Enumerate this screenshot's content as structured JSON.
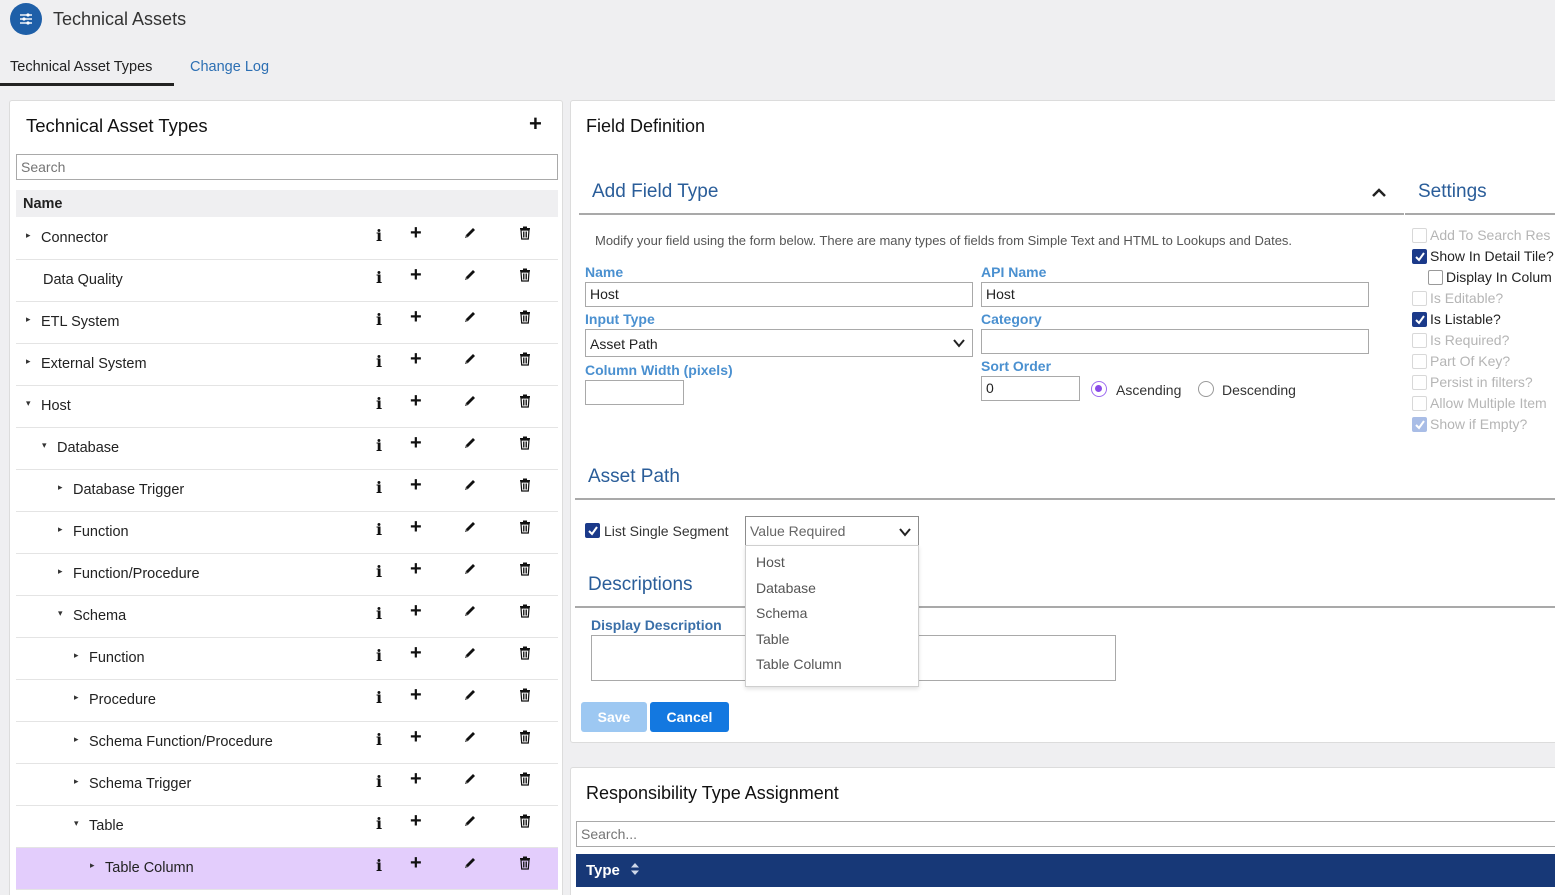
{
  "app": {
    "title": "Technical Assets",
    "icon": "sliders-icon"
  },
  "tabs": [
    {
      "label": "Technical Asset Types",
      "active": true
    },
    {
      "label": "Change Log",
      "active": false
    }
  ],
  "left_panel": {
    "title": "Technical Asset Types",
    "search_placeholder": "Search",
    "column_header": "Name",
    "rows": [
      {
        "label": "Connector",
        "caret": "collapsed",
        "depth": 0
      },
      {
        "label": "Data Quality",
        "caret": "none",
        "depth": 0
      },
      {
        "label": "ETL System",
        "caret": "collapsed",
        "depth": 0
      },
      {
        "label": "External System",
        "caret": "collapsed",
        "depth": 0
      },
      {
        "label": "Host",
        "caret": "expanded",
        "depth": 0
      },
      {
        "label": "Database",
        "caret": "expanded",
        "depth": 1
      },
      {
        "label": "Database Trigger",
        "caret": "collapsed",
        "depth": 2
      },
      {
        "label": "Function",
        "caret": "collapsed",
        "depth": 2
      },
      {
        "label": "Function/Procedure",
        "caret": "collapsed",
        "depth": 2
      },
      {
        "label": "Schema",
        "caret": "expanded",
        "depth": 2
      },
      {
        "label": "Function",
        "caret": "collapsed",
        "depth": 3
      },
      {
        "label": "Procedure",
        "caret": "collapsed",
        "depth": 3
      },
      {
        "label": "Schema Function/Procedure",
        "caret": "collapsed",
        "depth": 3
      },
      {
        "label": "Schema Trigger",
        "caret": "collapsed",
        "depth": 3
      },
      {
        "label": "Table",
        "caret": "expanded",
        "depth": 3
      },
      {
        "label": "Table Column",
        "caret": "collapsed",
        "depth": 4,
        "selected": true
      }
    ]
  },
  "field_definition": {
    "title": "Field Definition",
    "add_field_type": {
      "title": "Add Field Type",
      "hint": "Modify your field using the form below. There are many types of fields from Simple Text and HTML to Lookups and Dates.",
      "name_label": "Name",
      "name_value": "Host",
      "api_name_label": "API Name",
      "api_name_value": "Host",
      "input_type_label": "Input Type",
      "input_type_value": "Asset Path",
      "category_label": "Category",
      "category_value": "",
      "column_width_label": "Column Width (pixels)",
      "column_width_value": "",
      "sort_order_label": "Sort Order",
      "sort_order_value": "0",
      "ascending_label": "Ascending",
      "descending_label": "Descending",
      "sort_direction": "Ascending"
    },
    "settings": {
      "title": "Settings",
      "items": [
        {
          "label": "Add To Search Res",
          "checked": false,
          "enabled": false
        },
        {
          "label": "Show In Detail Tile?",
          "checked": true,
          "enabled": true
        },
        {
          "label": "Display In Colum",
          "checked": false,
          "enabled": true,
          "indent": true
        },
        {
          "label": "Is Editable?",
          "checked": false,
          "enabled": false
        },
        {
          "label": "Is Listable?",
          "checked": true,
          "enabled": true
        },
        {
          "label": "Is Required?",
          "checked": false,
          "enabled": false
        },
        {
          "label": "Part Of Key?",
          "checked": false,
          "enabled": false
        },
        {
          "label": "Persist in filters?",
          "checked": false,
          "enabled": false
        },
        {
          "label": "Allow Multiple Item",
          "checked": false,
          "enabled": false
        },
        {
          "label": "Show if Empty?",
          "checked": true,
          "enabled": false
        }
      ]
    },
    "asset_path": {
      "title": "Asset Path",
      "list_single_segment_label": "List Single Segment",
      "list_single_segment_checked": true,
      "segment_placeholder": "Value Required",
      "segment_options": [
        "Host",
        "Database",
        "Schema",
        "Table",
        "Table Column"
      ]
    },
    "descriptions": {
      "title": "Descriptions",
      "display_description_label": "Display Description",
      "display_description_value": ""
    },
    "buttons": {
      "save": "Save",
      "cancel": "Cancel"
    }
  },
  "responsibility": {
    "title": "Responsibility Type Assignment",
    "search_placeholder": "Search...",
    "column_header": "Type"
  },
  "colors": {
    "accent_blue": "#1378e0",
    "section_title": "#2a5d99",
    "field_label": "#4a90d0",
    "selected_row": "#e3cdfc",
    "table_header": "#173877"
  }
}
